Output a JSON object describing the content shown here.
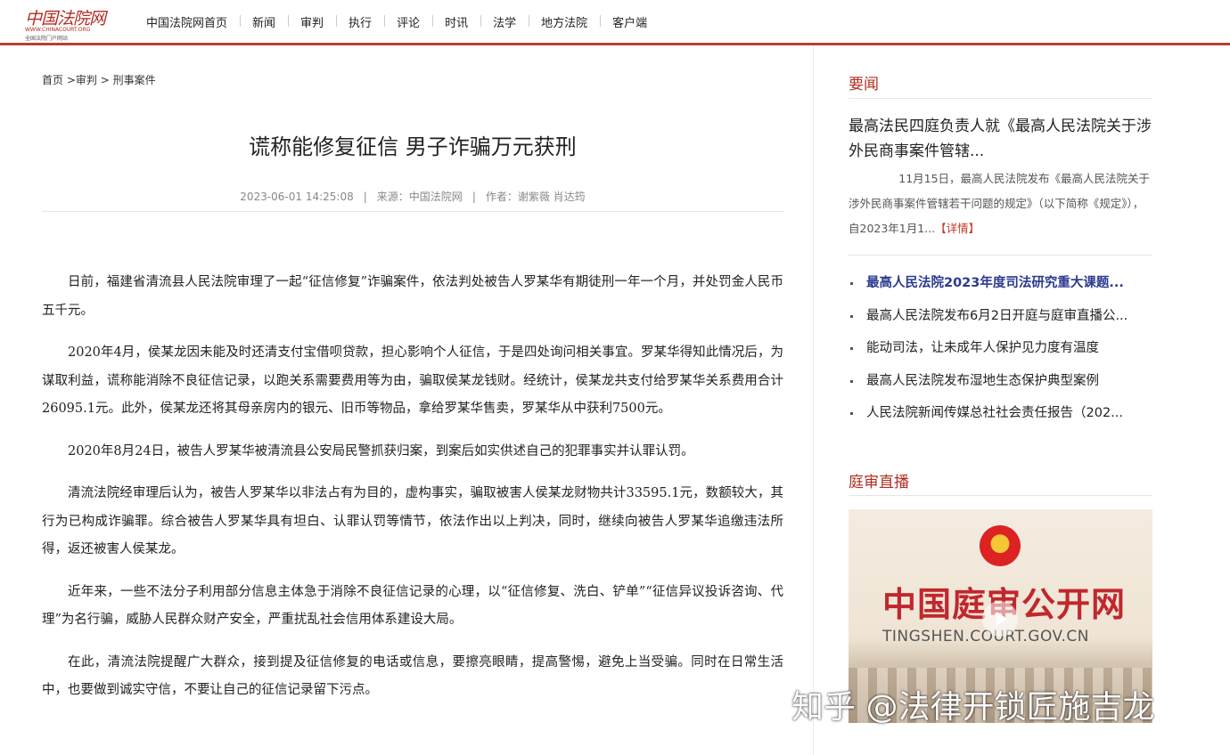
{
  "site": {
    "logo_cn": "中国法院网",
    "logo_en": "WWW.CHINACOURT.ORG",
    "logo_sub": "全国法院门户网站",
    "brand_color": "#b83f32"
  },
  "nav": [
    "中国法院网首页",
    "新闻",
    "审判",
    "执行",
    "评论",
    "时讯",
    "法学",
    "地方法院",
    "客户端"
  ],
  "breadcrumb": {
    "home": "首页",
    "sep1": ">",
    "level1": "审判",
    "sep2": ">",
    "level2": "刑事案件"
  },
  "article": {
    "title": "谎称能修复征信 男子诈骗万元获刑",
    "date": "2023-06-01 14:25:08",
    "sep": "|",
    "source": "来源：中国法院网",
    "author": "作者：谢紫薇 肖达筠",
    "paragraphs": [
      "日前，福建省清流县人民法院审理了一起“征信修复”诈骗案件，依法判处被告人罗某华有期徒刑一年一个月，并处罚金人民币五千元。",
      "2020年4月，侯某龙因未能及时还清支付宝借呗贷款，担心影响个人征信，于是四处询问相关事宜。罗某华得知此情况后，为谋取利益，谎称能消除不良征信记录，以跑关系需要费用等为由，骗取侯某龙钱财。经统计，侯某龙共支付给罗某华关系费用合计26095.1元。此外，侯某龙还将其母亲房内的银元、旧币等物品，拿给罗某华售卖，罗某华从中获利7500元。",
      "2020年8月24日，被告人罗某华被清流县公安局民警抓获归案，到案后如实供述自己的犯罪事实并认罪认罚。",
      "清流法院经审理后认为，被告人罗某华以非法占有为目的，虚构事实，骗取被害人侯某龙财物共计33595.1元，数额较大，其行为已构成诈骗罪。综合被告人罗某华具有坦白、认罪认罚等情节，依法作出以上判决，同时，继续向被告人罗某华追缴违法所得，返还被害人侯某龙。",
      "近年来，一些不法分子利用部分信息主体急于消除不良征信记录的心理，以“征信修复、洗白、铲单”“征信异议投诉咨询、代理”为名行骗，威胁人民群众财产安全，严重扰乱社会信用体系建设大局。",
      "在此，清流法院提醒广大群众，接到提及征信修复的电话或信息，要擦亮眼睛，提高警惕，避免上当受骗。同时在日常生活中，也要做到诚实守信，不要让自己的征信记录留下污点。"
    ]
  },
  "sidebar": {
    "news_heading": "要闻",
    "feature": {
      "title": "最高法民四庭负责人就《最高人民法院关于涉外民商事案件管辖...",
      "summary": "11月15日，最高人民法院发布《最高人民法院关于涉外民商事案件管辖若干问题的规定》（以下简称《规定》），自2023年1月1...",
      "more": "【详情】"
    },
    "news": [
      "最高人民法院2023年度司法研究重大课题...",
      "最高人民法院发布6月2日开庭与庭审直播公...",
      "能动司法，让未成年人保护见力度有温度",
      "最高人民法院发布湿地生态保护典型案例",
      "人民法院新闻传媒总社社会责任报告（202..."
    ],
    "live_heading": "庭审直播",
    "banner_cn": "中国庭审公开网",
    "banner_en": "TINGSHEN.COURT.GOV.CN"
  },
  "watermark": "知乎 @法律开锁匠施吉龙"
}
